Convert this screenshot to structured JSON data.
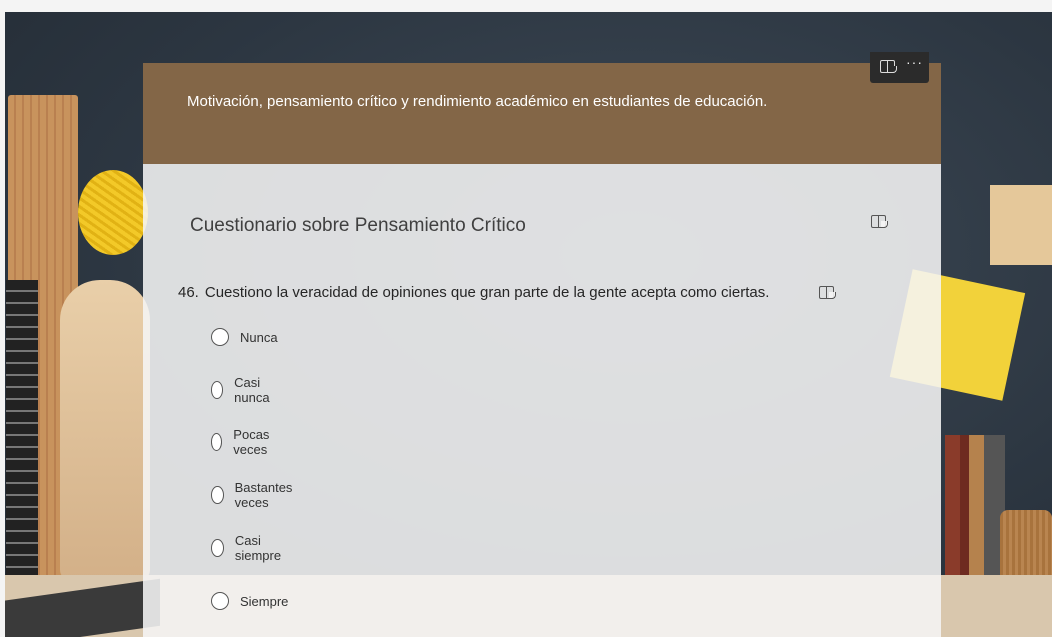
{
  "form": {
    "header_title": "Motivación, pensamiento crítico y rendimiento académico en estudiantes de educación.",
    "section_title": "Cuestionario sobre  Pensamiento Crítico",
    "question": {
      "number": "46.",
      "text": "Cuestiono la veracidad de opiniones que gran parte de la gente acepta como ciertas."
    },
    "options": [
      "Nunca",
      "Casi nunca",
      "Pocas veces",
      "Bastantes veces",
      "Casi siempre",
      "Siempre"
    ]
  },
  "toolbar": {
    "reader_icon": "immersive-reader-icon",
    "more_icon": "more-options-icon",
    "more_glyph": "···"
  },
  "colors": {
    "header_bg": "#836647",
    "body_bg": "#f5f5f5",
    "toolbar_bg": "#2b2b2b"
  }
}
